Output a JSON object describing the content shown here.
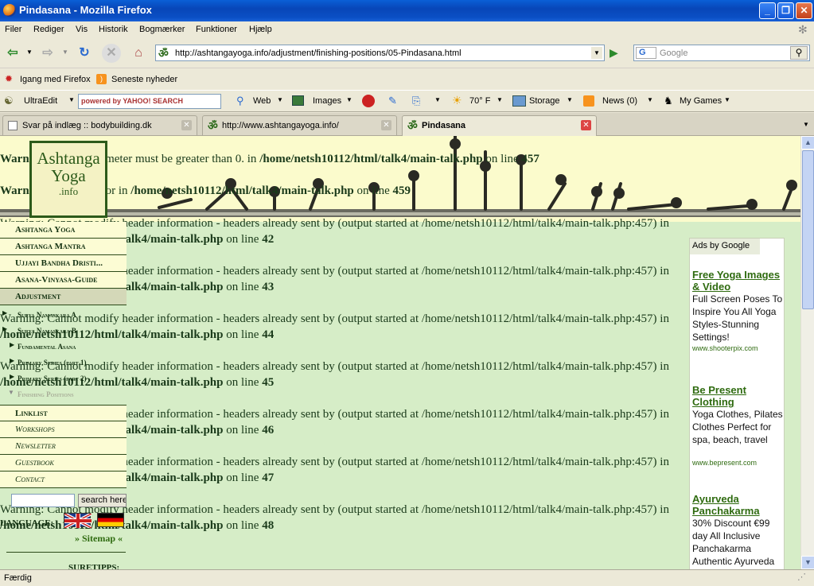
{
  "window": {
    "title": "Pindasana - Mozilla Firefox",
    "min": "_",
    "max": "❐",
    "close": "✕"
  },
  "menubar": [
    "Filer",
    "Rediger",
    "Vis",
    "Historik",
    "Bogmærker",
    "Funktioner",
    "Hjælp"
  ],
  "nav": {
    "url": "http://ashtangayoga.info/adjustment/finishing-positions/05-Pindasana.html",
    "search_placeholder": "Google",
    "search_engine": "G"
  },
  "bookmarks": [
    "Igang med Firefox",
    "Seneste nyheder"
  ],
  "toolbar": {
    "ultraedit": "UltraEdit",
    "yahoo_placeholder": "powered by YAHOO! SEARCH",
    "web": "Web",
    "images": "Images",
    "weather": "70° F",
    "storage": "Storage",
    "news": "News (0)",
    "games": "My Games"
  },
  "tabs": [
    {
      "label": "Svar på indlæg :: bodybuilding.dk",
      "active": false
    },
    {
      "label": "http://www.ashtangayoga.info/",
      "active": false
    },
    {
      "label": "Pindasana",
      "active": true
    }
  ],
  "page": {
    "logo": {
      "line1": "Ashtanga",
      "line2": "Yoga",
      "line3": ".info"
    },
    "warnings": [
      {
        "pre": "Warning",
        "text": ": ...ngth parameter must be greater than 0. in ",
        "file": "/home/netsh10112/html/talk4/main-talk.php",
        "mid": " on line ",
        "line": "457"
      },
      {
        "pre": "Warning",
        "text": ": ...buffer error in ",
        "file": "/home/netsh10112/html/talk4/main-talk.php",
        "mid": " on line ",
        "line": "459"
      }
    ],
    "header_warnings": [
      {
        "text": "Warning: Cannot modify header information - headers already sent by (output started at /home/netsh10112/html/talk4/main-talk.php:457) in",
        "file": "/home/netsh10112/html/talk4/main-talk.php",
        "mid": " on line ",
        "line": "42"
      },
      {
        "text": "Warning: Cannot modify header information - headers already sent by (output started at /home/netsh10112/html/talk4/main-talk.php:457) in",
        "file": "/home/netsh10112/html/talk4/main-talk.php",
        "mid": " on line ",
        "line": "43"
      },
      {
        "text": "Warning: Cannot modify header information - headers already sent by (output started at /home/netsh10112/html/talk4/main-talk.php:457) in",
        "file": "/home/netsh10112/html/talk4/main-talk.php",
        "mid": " on line ",
        "line": "44"
      },
      {
        "text": "Warning: Cannot modify header information - headers already sent by (output started at /home/netsh10112/html/talk4/main-talk.php:457) in",
        "file": "/home/netsh10112/html/talk4/main-talk.php",
        "mid": " on line ",
        "line": "45"
      },
      {
        "text": "Warning: Cannot modify header information - headers already sent by (output started at /home/netsh10112/html/talk4/main-talk.php:457) in",
        "file": "/home/netsh10112/html/talk4/main-talk.php",
        "mid": " on line ",
        "line": "46"
      },
      {
        "text": "Warning: Cannot modify header information - headers already sent by (output started at /home/netsh10112/html/talk4/main-talk.php:457) in",
        "file": "/home/netsh10112/html/talk4/main-talk.php",
        "mid": " on line ",
        "line": "47"
      },
      {
        "text": "Warning: Cannot modify header information - headers already sent by (output started at /home/netsh10112/html/talk4/main-talk.php:457) in",
        "file": "/home/netsh10112/html/talk4/main-talk.php",
        "mid": " on line ",
        "line": "48"
      }
    ],
    "menu": [
      "Ashtanga Yoga",
      "Ashtanga Mantra",
      "Ujjayi Bandha Dristi...",
      "Asana-Vinyasa-Guide",
      "Adjustment"
    ],
    "submenu": [
      "Surya Namaskara A",
      "Surya Namaskara B",
      "Fundamental Asana",
      "Primary Series (part 1)",
      "Primary Series (part 2)",
      "Finishing Positions"
    ],
    "menu2": [
      "Linklist",
      "Workshops",
      "Newsletter",
      "Guestbook",
      "Contact"
    ],
    "search_button": "search here",
    "language_label": "LANGUAGE:",
    "sitemap": "» Sitemap «",
    "suretipps": "SURETIPPS:"
  },
  "ads": {
    "header": "Ads by Google",
    "items": [
      {
        "title": "Free Yoga Images & Video",
        "text": "Full Screen Poses To Inspire You All Yoga Styles-Stunning Settings!",
        "url": "www.shooterpix.com"
      },
      {
        "title": "Be Present Clothing",
        "text": "Yoga Clothes, Pilates Clothes Perfect for spa, beach, travel",
        "url": "www.bepresent.com"
      },
      {
        "title": "Ayurveda Panchakarma",
        "text": "30% Discount €99 day All Inclusive Panchakarma Authentic Ayurveda",
        "url": ""
      }
    ]
  },
  "status": "Færdig",
  "colors": {
    "page_bg": "#d6edc7",
    "top_band": "#fbfbcc",
    "link_green": "#2f6b10",
    "xp_blue": "#0846b8"
  }
}
